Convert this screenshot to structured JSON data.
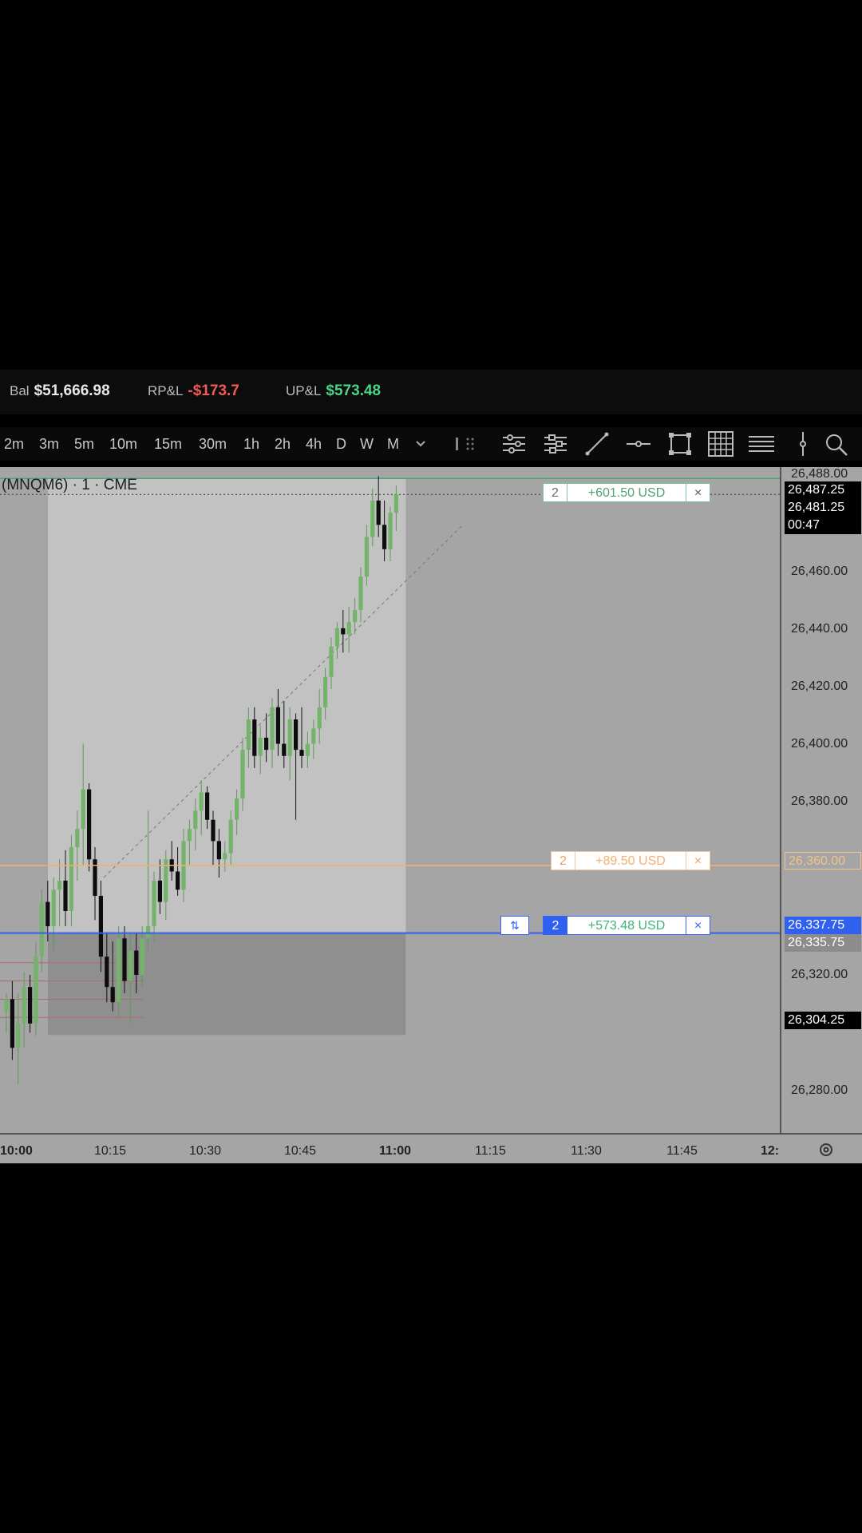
{
  "account": {
    "balance_label": "Bal",
    "balance_value": "$51,666.98",
    "rpnl_label": "RP&L",
    "rpnl_value": "-$173.7",
    "upnl_label": "UP&L",
    "upnl_value": "$573.48"
  },
  "timeframes": [
    "2m",
    "3m",
    "5m",
    "10m",
    "15m",
    "30m",
    "1h",
    "2h",
    "4h",
    "D",
    "W",
    "M"
  ],
  "toolbar_icons": [
    "chevron-down-icon",
    "grip-icon",
    "bar-settings-icon",
    "bar-list-icon",
    "trend-line-icon",
    "horizontal-line-icon",
    "rectangle-icon",
    "grid-icon",
    "lines-icon",
    "vertical-line-icon",
    "zoom-icon"
  ],
  "chart": {
    "symbol": "(MNQM6) · 1 · CME",
    "price_ticks": [
      "26,488.00",
      "26,460.00",
      "26,440.00",
      "26,420.00",
      "26,400.00",
      "26,380.00",
      "26,360.00",
      "26,320.00",
      "26,280.00"
    ],
    "time_ticks": [
      "10:00",
      "10:15",
      "10:30",
      "10:45",
      "11:00",
      "11:15",
      "11:30",
      "11:45",
      "12:"
    ],
    "labels": {
      "high": "26,487.25",
      "last_price": "26,481.25",
      "countdown": "00:47",
      "target": "26,360.00",
      "entry": "26,337.75",
      "entry_gray": "26,335.75",
      "low_box": "26,304.25"
    },
    "orders": {
      "profit_target": {
        "qty": "2",
        "pnl": "+601.50 USD",
        "close": "×"
      },
      "limit": {
        "qty": "2",
        "pnl": "+89.50 USD",
        "close": "×"
      },
      "position": {
        "qty": "2",
        "pnl": "+573.48 USD",
        "close": "×",
        "reverse": "⇅"
      }
    }
  },
  "colors": {
    "chart_bg": "#a5a5a5",
    "bull_candle": "#73b36a",
    "bear_candle": "#0d0d0d",
    "position_line": "#2f60f0",
    "limit_line": "#f5b06a",
    "target_line": "#4fa372"
  },
  "chart_data": {
    "type": "candlestick",
    "candles": [
      {
        "o": 26312,
        "h": 26318,
        "l": 26305,
        "c": 26316
      },
      {
        "o": 26316,
        "h": 26322,
        "l": 26296,
        "c": 26300
      },
      {
        "o": 26300,
        "h": 26318,
        "l": 26288,
        "c": 26308
      },
      {
        "o": 26308,
        "h": 26325,
        "l": 26300,
        "c": 26320
      },
      {
        "o": 26320,
        "h": 26324,
        "l": 26305,
        "c": 26308
      },
      {
        "o": 26308,
        "h": 26335,
        "l": 26304,
        "c": 26330
      },
      {
        "o": 26330,
        "h": 26352,
        "l": 26325,
        "c": 26348
      },
      {
        "o": 26348,
        "h": 26355,
        "l": 26335,
        "c": 26340
      },
      {
        "o": 26340,
        "h": 26356,
        "l": 26332,
        "c": 26352
      },
      {
        "o": 26352,
        "h": 26362,
        "l": 26340,
        "c": 26355
      },
      {
        "o": 26355,
        "h": 26365,
        "l": 26340,
        "c": 26345
      },
      {
        "o": 26345,
        "h": 26370,
        "l": 26340,
        "c": 26366
      },
      {
        "o": 26366,
        "h": 26378,
        "l": 26355,
        "c": 26372
      },
      {
        "o": 26372,
        "h": 26400,
        "l": 26360,
        "c": 26385
      },
      {
        "o": 26385,
        "h": 26387,
        "l": 26358,
        "c": 26362
      },
      {
        "o": 26362,
        "h": 26366,
        "l": 26342,
        "c": 26350
      },
      {
        "o": 26350,
        "h": 26355,
        "l": 26325,
        "c": 26330
      },
      {
        "o": 26330,
        "h": 26338,
        "l": 26315,
        "c": 26320
      },
      {
        "o": 26320,
        "h": 26335,
        "l": 26312,
        "c": 26315
      },
      {
        "o": 26315,
        "h": 26340,
        "l": 26310,
        "c": 26336
      },
      {
        "o": 26336,
        "h": 26340,
        "l": 26318,
        "c": 26322
      },
      {
        "o": 26322,
        "h": 26338,
        "l": 26308,
        "c": 26332
      },
      {
        "o": 26332,
        "h": 26338,
        "l": 26318,
        "c": 26324
      },
      {
        "o": 26324,
        "h": 26340,
        "l": 26320,
        "c": 26336
      },
      {
        "o": 26336,
        "h": 26378,
        "l": 26332,
        "c": 26340
      },
      {
        "o": 26340,
        "h": 26358,
        "l": 26335,
        "c": 26355
      },
      {
        "o": 26355,
        "h": 26362,
        "l": 26344,
        "c": 26348
      },
      {
        "o": 26348,
        "h": 26365,
        "l": 26342,
        "c": 26362
      },
      {
        "o": 26362,
        "h": 26368,
        "l": 26355,
        "c": 26358
      },
      {
        "o": 26358,
        "h": 26366,
        "l": 26350,
        "c": 26352
      },
      {
        "o": 26352,
        "h": 26372,
        "l": 26348,
        "c": 26368
      },
      {
        "o": 26368,
        "h": 26375,
        "l": 26360,
        "c": 26372
      },
      {
        "o": 26372,
        "h": 26382,
        "l": 26365,
        "c": 26378
      },
      {
        "o": 26378,
        "h": 26388,
        "l": 26370,
        "c": 26384
      },
      {
        "o": 26384,
        "h": 26386,
        "l": 26372,
        "c": 26375
      },
      {
        "o": 26375,
        "h": 26378,
        "l": 26360,
        "c": 26368
      },
      {
        "o": 26368,
        "h": 26372,
        "l": 26356,
        "c": 26362
      },
      {
        "o": 26362,
        "h": 26368,
        "l": 26358,
        "c": 26364
      },
      {
        "o": 26364,
        "h": 26378,
        "l": 26360,
        "c": 26375
      },
      {
        "o": 26375,
        "h": 26385,
        "l": 26370,
        "c": 26382
      },
      {
        "o": 26382,
        "h": 26402,
        "l": 26378,
        "c": 26398
      },
      {
        "o": 26398,
        "h": 26412,
        "l": 26392,
        "c": 26408
      },
      {
        "o": 26408,
        "h": 26412,
        "l": 26392,
        "c": 26396
      },
      {
        "o": 26396,
        "h": 26406,
        "l": 26390,
        "c": 26402
      },
      {
        "o": 26402,
        "h": 26410,
        "l": 26394,
        "c": 26398
      },
      {
        "o": 26398,
        "h": 26415,
        "l": 26392,
        "c": 26412
      },
      {
        "o": 26412,
        "h": 26418,
        "l": 26396,
        "c": 26400
      },
      {
        "o": 26400,
        "h": 26414,
        "l": 26392,
        "c": 26396
      },
      {
        "o": 26396,
        "h": 26412,
        "l": 26388,
        "c": 26408
      },
      {
        "o": 26408,
        "h": 26410,
        "l": 26375,
        "c": 26398
      },
      {
        "o": 26398,
        "h": 26412,
        "l": 26392,
        "c": 26396
      },
      {
        "o": 26396,
        "h": 26404,
        "l": 26392,
        "c": 26400
      },
      {
        "o": 26400,
        "h": 26408,
        "l": 26395,
        "c": 26405
      },
      {
        "o": 26405,
        "h": 26418,
        "l": 26400,
        "c": 26412
      },
      {
        "o": 26412,
        "h": 26425,
        "l": 26408,
        "c": 26422
      },
      {
        "o": 26422,
        "h": 26435,
        "l": 26418,
        "c": 26432
      },
      {
        "o": 26432,
        "h": 26440,
        "l": 26428,
        "c": 26438
      },
      {
        "o": 26438,
        "h": 26444,
        "l": 26430,
        "c": 26436
      },
      {
        "o": 26436,
        "h": 26445,
        "l": 26430,
        "c": 26440
      },
      {
        "o": 26440,
        "h": 26448,
        "l": 26436,
        "c": 26444
      },
      {
        "o": 26444,
        "h": 26458,
        "l": 26440,
        "c": 26455
      },
      {
        "o": 26455,
        "h": 26472,
        "l": 26452,
        "c": 26468
      },
      {
        "o": 26468,
        "h": 26484,
        "l": 26465,
        "c": 26480
      },
      {
        "o": 26480,
        "h": 26488,
        "l": 26468,
        "c": 26472
      },
      {
        "o": 26472,
        "h": 26480,
        "l": 26460,
        "c": 26464
      },
      {
        "o": 26464,
        "h": 26478,
        "l": 26460,
        "c": 26476
      },
      {
        "o": 26476,
        "h": 26485,
        "l": 26470,
        "c": 26482
      }
    ],
    "position_box": {
      "top": 26487.25,
      "entry": 26337.75,
      "bottom": 26304.25
    },
    "y_range": [
      26272,
      26491
    ],
    "grid": false
  }
}
